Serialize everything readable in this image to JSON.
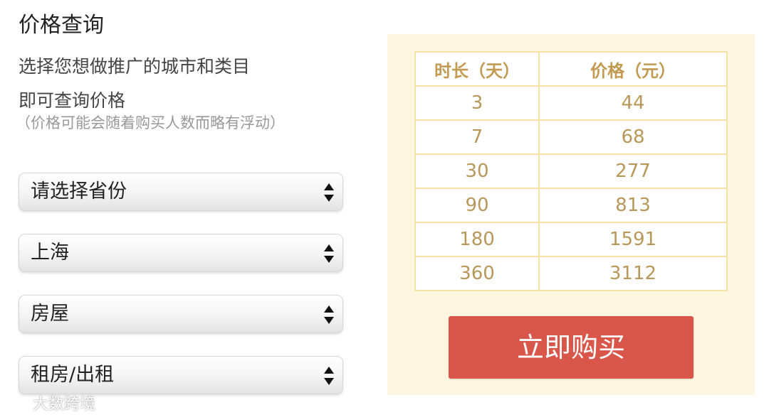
{
  "header": {
    "title": "价格查询",
    "desc_line1": "选择您想做推广的城市和类目",
    "desc_line2": "即可查询价格",
    "note": "（价格可能会随着购买人数而略有浮动）"
  },
  "selects": {
    "province": "请选择省份",
    "city": "上海",
    "category": "房屋",
    "subcategory": "租房/出租"
  },
  "price_table": {
    "headers": [
      "时长（天）",
      "价格（元）"
    ],
    "rows": [
      {
        "days": "3",
        "price": "44"
      },
      {
        "days": "7",
        "price": "68"
      },
      {
        "days": "30",
        "price": "277"
      },
      {
        "days": "90",
        "price": "813"
      },
      {
        "days": "180",
        "price": "1591"
      },
      {
        "days": "360",
        "price": "3112"
      }
    ]
  },
  "buy_button": "立即购买",
  "watermark": "大数跨境",
  "colors": {
    "panel_bg": "#fdf7e1",
    "table_border": "#f3e4a6",
    "table_text": "#b8985a",
    "button_bg": "#d9564a"
  }
}
